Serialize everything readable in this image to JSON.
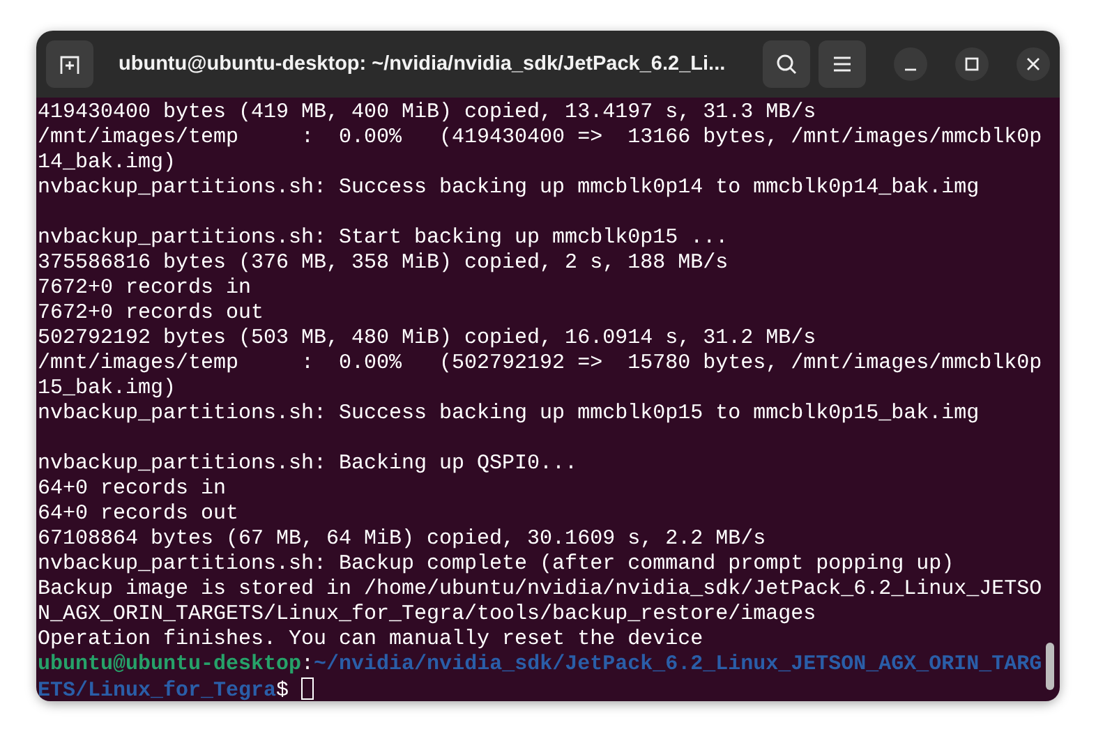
{
  "window": {
    "title": "ubuntu@ubuntu-desktop: ~/nvidia/nvidia_sdk/JetPack_6.2_Li..."
  },
  "terminal": {
    "lines": [
      {
        "kind": "output",
        "text": "419430400 bytes (419 MB, 400 MiB) copied, 13.4197 s, 31.3 MB/s"
      },
      {
        "kind": "output",
        "text": "/mnt/images/temp     :  0.00%   (419430400 =>  13166 bytes, /mnt/images/mmcblk0p14_bak.img)"
      },
      {
        "kind": "output",
        "text": "nvbackup_partitions.sh: Success backing up mmcblk0p14 to mmcblk0p14_bak.img"
      },
      {
        "kind": "blank"
      },
      {
        "kind": "output",
        "text": "nvbackup_partitions.sh: Start backing up mmcblk0p15 ..."
      },
      {
        "kind": "output",
        "text": "375586816 bytes (376 MB, 358 MiB) copied, 2 s, 188 MB/s"
      },
      {
        "kind": "output",
        "text": "7672+0 records in"
      },
      {
        "kind": "output",
        "text": "7672+0 records out"
      },
      {
        "kind": "output",
        "text": "502792192 bytes (503 MB, 480 MiB) copied, 16.0914 s, 31.2 MB/s"
      },
      {
        "kind": "output",
        "text": "/mnt/images/temp     :  0.00%   (502792192 =>  15780 bytes, /mnt/images/mmcblk0p15_bak.img)"
      },
      {
        "kind": "output",
        "text": "nvbackup_partitions.sh: Success backing up mmcblk0p15 to mmcblk0p15_bak.img"
      },
      {
        "kind": "blank"
      },
      {
        "kind": "output",
        "text": "nvbackup_partitions.sh: Backing up QSPI0..."
      },
      {
        "kind": "output",
        "text": "64+0 records in"
      },
      {
        "kind": "output",
        "text": "64+0 records out"
      },
      {
        "kind": "output",
        "text": "67108864 bytes (67 MB, 64 MiB) copied, 30.1609 s, 2.2 MB/s"
      },
      {
        "kind": "output",
        "text": "nvbackup_partitions.sh: Backup complete (after command prompt popping up)"
      },
      {
        "kind": "output",
        "text": "Backup image is stored in /home/ubuntu/nvidia/nvidia_sdk/JetPack_6.2_Linux_JETSON_AGX_ORIN_TARGETS/Linux_for_Tegra/tools/backup_restore/images"
      },
      {
        "kind": "output",
        "text": "Operation finishes. You can manually reset the device"
      },
      {
        "kind": "prompt",
        "user": "ubuntu@ubuntu-desktop",
        "separator": ":",
        "path": "~/nvidia/nvidia_sdk/JetPack_6.2_Linux_JETSON_AGX_ORIN_TARGETS/Linux_for_Tegra",
        "symbol": "$"
      }
    ]
  }
}
